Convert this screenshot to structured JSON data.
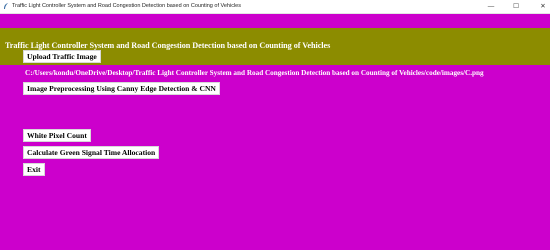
{
  "window": {
    "title": "Traffic Light Controller System and Road Congestion Detection based on Counting of Vehicles",
    "minimize_glyph": "—",
    "maximize_glyph": "☐",
    "close_glyph": "✕"
  },
  "header": {
    "title": "Traffic Light Controller System and Road Congestion Detection based on Counting of Vehicles"
  },
  "buttons": {
    "upload": "Upload Traffic Image",
    "preprocess": "Image Preprocessing Using Canny Edge Detection & CNN",
    "white_pixel": "White Pixel Count",
    "green_signal": "Calculate Green Signal Time Allocation",
    "exit": "Exit"
  },
  "status": {
    "image_path": "C:/Users/kondu/OneDrive/Desktop/Traffic Light Controller System and Road Congestion Detection based on Counting of Vehicles/code/images/C.png"
  },
  "colors": {
    "background": "#cc00cc",
    "header_band": "#8c8c00",
    "button_bg": "#ffffff"
  }
}
